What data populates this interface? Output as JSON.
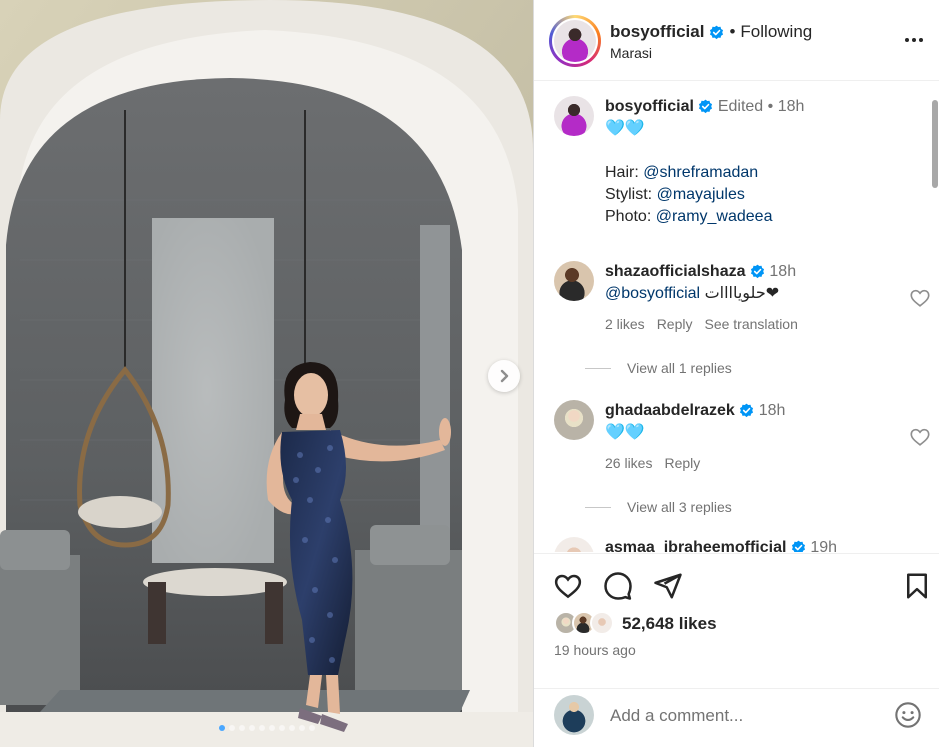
{
  "post": {
    "author": "bosyofficial",
    "follow_separator": "•",
    "follow_status": "Following",
    "location": "Marasi",
    "carousel_slide_count": 10,
    "carousel_active_index": 0
  },
  "caption": {
    "username": "bosyofficial",
    "edited_label": "Edited",
    "separator": "•",
    "time": "18h",
    "line1": "🩵🩵",
    "hair_label": "Hair:",
    "hair_mention": "@shreframadan",
    "stylist_label": "Stylist:",
    "stylist_mention": "@mayajules",
    "photo_label": "Photo:",
    "photo_mention": "@ramy_wadeea"
  },
  "comments": [
    {
      "username": "shazaofficialshaza",
      "time": "18h",
      "mention": "@bosyofficial",
      "text": "حلوياااات❤",
      "likes": "2 likes",
      "reply": "Reply",
      "translate": "See translation",
      "view_replies": "View all 1 replies"
    },
    {
      "username": "ghadaabdelrazek",
      "time": "18h",
      "text": "🩵🩵",
      "likes": "26 likes",
      "reply": "Reply",
      "view_replies": "View all 3 replies"
    },
    {
      "username": "asmaa_ibraheemofficial",
      "time": "19h"
    }
  ],
  "engagement": {
    "likes_text": "52,648 likes",
    "time_ago": "19 hours ago"
  },
  "composer": {
    "placeholder": "Add a comment..."
  },
  "colors": {
    "verified": "#0095f6",
    "muted": "#737373",
    "mention": "#00376b",
    "active_dot": "#4aa7ff"
  },
  "icons": [
    "verified-badge-icon",
    "more-options-icon",
    "heart-icon",
    "comment-icon",
    "share-icon",
    "bookmark-icon",
    "emoji-icon",
    "chevron-right-icon"
  ]
}
